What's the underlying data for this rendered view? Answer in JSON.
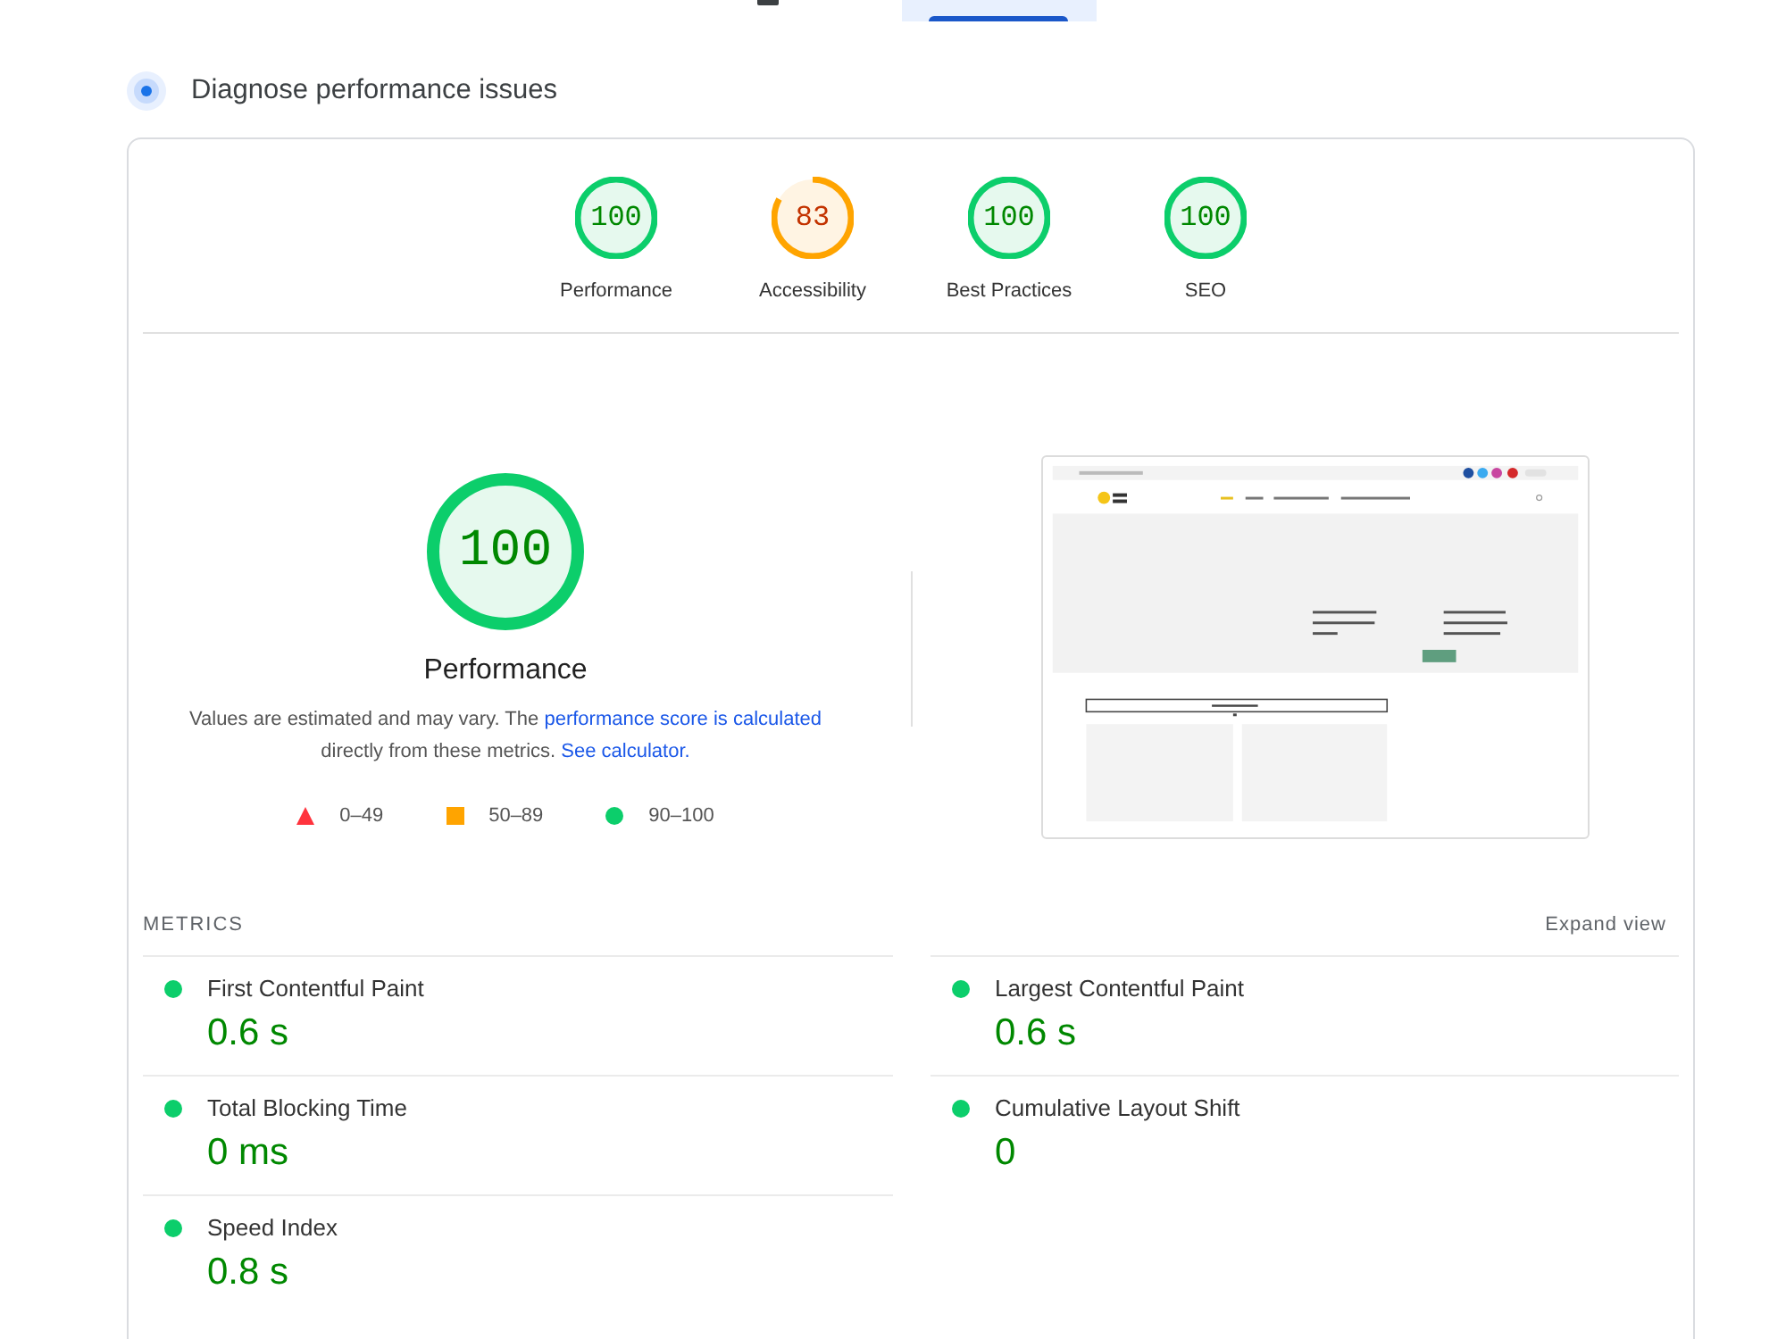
{
  "device_tabs": [
    {
      "selected": false
    },
    {
      "selected": true
    }
  ],
  "header": {
    "title": "Diagnose performance issues"
  },
  "gauges": [
    {
      "score": "100",
      "label": "Performance",
      "kind": "pass",
      "level": 1
    },
    {
      "score": "83",
      "label": "Accessibility",
      "kind": "average",
      "level": 0.83
    },
    {
      "score": "100",
      "label": "Best Practices",
      "kind": "pass",
      "level": 1
    },
    {
      "score": "100",
      "label": "SEO",
      "kind": "pass",
      "level": 1
    }
  ],
  "summary": {
    "score": "100",
    "level": 1,
    "kind": "pass",
    "title": "Performance",
    "description": [
      {
        "kind": "text",
        "text": "Values are estimated and may vary. The "
      },
      {
        "kind": "link",
        "text": "performance score is calculated"
      },
      {
        "kind": "text",
        "text": " directly from these metrics. "
      },
      {
        "kind": "link",
        "text": "See calculator."
      }
    ],
    "legend": [
      {
        "kind": "fail",
        "range": "0–49"
      },
      {
        "kind": "average",
        "range": "50–89"
      },
      {
        "kind": "pass",
        "range": "90–100"
      }
    ]
  },
  "metrics_panel": {
    "heading": "METRICS",
    "toggle": "Expand view",
    "metrics": [
      {
        "label": "First Contentful Paint",
        "value": "0.6 s",
        "kind": "pass"
      },
      {
        "label": "Largest Contentful Paint",
        "value": "0.6 s",
        "kind": "pass"
      },
      {
        "label": "Total Blocking Time",
        "value": "0 ms",
        "kind": "pass"
      },
      {
        "label": "Cumulative Layout Shift",
        "value": "0",
        "kind": "pass"
      },
      {
        "label": "Speed Index",
        "value": "0.8 s",
        "kind": "pass"
      }
    ]
  }
}
